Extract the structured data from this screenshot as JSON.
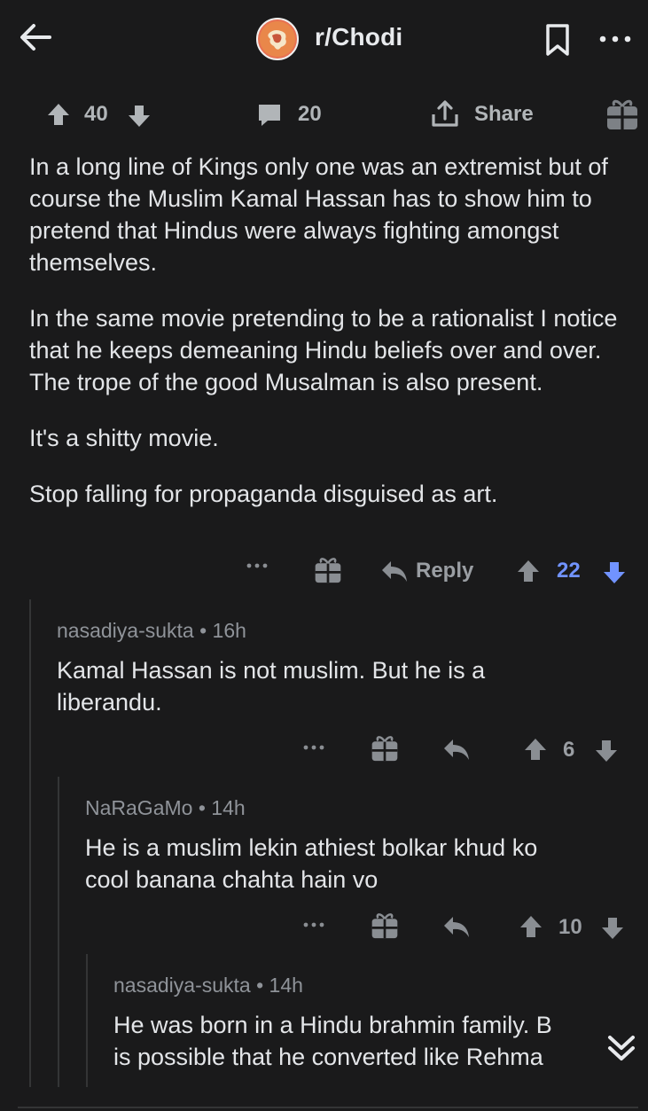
{
  "header": {
    "subreddit": "r/Chodi",
    "icons": [
      "back-arrow-icon",
      "subreddit-avatar",
      "bookmark-icon",
      "more-options-icon"
    ]
  },
  "post_actions": {
    "upvotes": "40",
    "comments": "20",
    "share_label": "Share"
  },
  "comment": {
    "paragraphs": [
      "In a long line of Kings only one was an extremist but of course the Muslim Kamal Hassan has to show him  to pretend that Hindus were always fighting amongst themselves.",
      "In the same movie pretending to be a rationalist I notice that he keeps demeaning Hindu beliefs over and over. The trope of the good Musalman is also present.",
      "It's a shitty movie.",
      "Stop falling for propaganda disguised as art."
    ],
    "actions": {
      "reply_label": "Reply",
      "score": "22"
    },
    "colors": {
      "downvoted": "#7193ff"
    }
  },
  "replies": [
    {
      "author": "nasadiya-sukta",
      "age": "16h",
      "text_lines": [
        "Kamal Hassan is not muslim. But he is a",
        "liberandu."
      ],
      "score": "6"
    },
    {
      "author": "NaRaGaMo",
      "age": "14h",
      "text_lines": [
        "He is a muslim lekin athiest bolkar khud ko",
        "cool banana chahta hain vo"
      ],
      "score": "10"
    },
    {
      "author": "nasadiya-sukta",
      "age": "14h",
      "text_lines": [
        "He was born in a Hindu brahmin family. B",
        "is possible that he converted like Rehma"
      ]
    }
  ],
  "separator": "•"
}
